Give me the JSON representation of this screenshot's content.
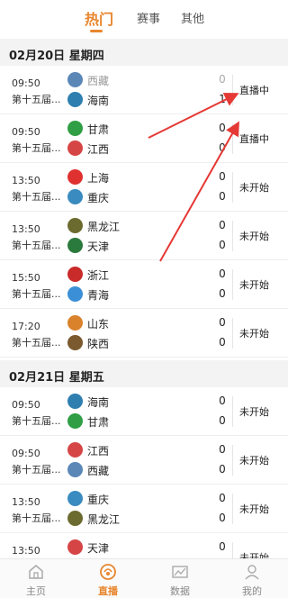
{
  "tabs": [
    {
      "label": "热门"
    },
    {
      "label": "赛事"
    },
    {
      "label": "其他"
    }
  ],
  "sections": [
    {
      "date": "02月20日 星期四",
      "matches": [
        {
          "time": "09:50",
          "league": "第十五届...",
          "home": {
            "name": "西藏",
            "logo": "xizang-logo"
          },
          "away": {
            "name": "海南",
            "logo": "hainan-logo"
          },
          "home_score": "0",
          "away_score": "1",
          "status": "直播中"
        },
        {
          "time": "09:50",
          "league": "第十五届...",
          "home": {
            "name": "甘肃",
            "logo": "gansu-logo"
          },
          "away": {
            "name": "江西",
            "logo": "jiangxi-logo"
          },
          "home_score": "0",
          "away_score": "0",
          "status": "直播中"
        },
        {
          "time": "13:50",
          "league": "第十五届...",
          "home": {
            "name": "上海",
            "logo": "shanghai-logo"
          },
          "away": {
            "name": "重庆",
            "logo": "chongqing-logo"
          },
          "home_score": "0",
          "away_score": "0",
          "status": "未开始"
        },
        {
          "time": "13:50",
          "league": "第十五届...",
          "home": {
            "name": "黑龙江",
            "logo": "heilongjiang-logo"
          },
          "away": {
            "name": "天津",
            "logo": "tianjin-logo"
          },
          "home_score": "0",
          "away_score": "0",
          "status": "未开始"
        },
        {
          "time": "15:50",
          "league": "第十五届...",
          "home": {
            "name": "浙江",
            "logo": "zhejiang-logo"
          },
          "away": {
            "name": "青海",
            "logo": "qinghai-logo"
          },
          "home_score": "0",
          "away_score": "0",
          "status": "未开始"
        },
        {
          "time": "17:20",
          "league": "第十五届...",
          "home": {
            "name": "山东",
            "logo": "shandong-logo"
          },
          "away": {
            "name": "陕西",
            "logo": "shaanxi-logo"
          },
          "home_score": "0",
          "away_score": "0",
          "status": "未开始"
        }
      ]
    },
    {
      "date": "02月21日 星期五",
      "matches": [
        {
          "time": "09:50",
          "league": "第十五届...",
          "home": {
            "name": "海南",
            "logo": "hainan-logo"
          },
          "away": {
            "name": "甘肃",
            "logo": "gansu-logo"
          },
          "home_score": "0",
          "away_score": "0",
          "status": "未开始"
        },
        {
          "time": "09:50",
          "league": "第十五届...",
          "home": {
            "name": "江西",
            "logo": "jiangxi-logo"
          },
          "away": {
            "name": "西藏",
            "logo": "xizang-logo"
          },
          "home_score": "0",
          "away_score": "0",
          "status": "未开始"
        },
        {
          "time": "13:50",
          "league": "第十五届...",
          "home": {
            "name": "重庆",
            "logo": "chongqing-logo"
          },
          "away": {
            "name": "黑龙江",
            "logo": "heilongjiang-logo"
          },
          "home_score": "0",
          "away_score": "0",
          "status": "未开始"
        },
        {
          "time": "13:50",
          "league": "第十五届...",
          "home": {
            "name": "天津",
            "logo": "tianjin-logo"
          },
          "away": {
            "name": "",
            "logo": "unknown-logo"
          },
          "home_score": "0",
          "away_score": "",
          "status": "未开始"
        }
      ]
    }
  ],
  "bottom_nav": [
    {
      "label": "主页",
      "icon": "home-icon"
    },
    {
      "label": "直播",
      "icon": "live-icon"
    },
    {
      "label": "数据",
      "icon": "data-icon"
    },
    {
      "label": "我的",
      "icon": "profile-icon"
    }
  ],
  "colors": {
    "accent": "#e8862d",
    "annotation_arrow": "#e53935",
    "date_bar_bg": "#f3f3f3"
  }
}
